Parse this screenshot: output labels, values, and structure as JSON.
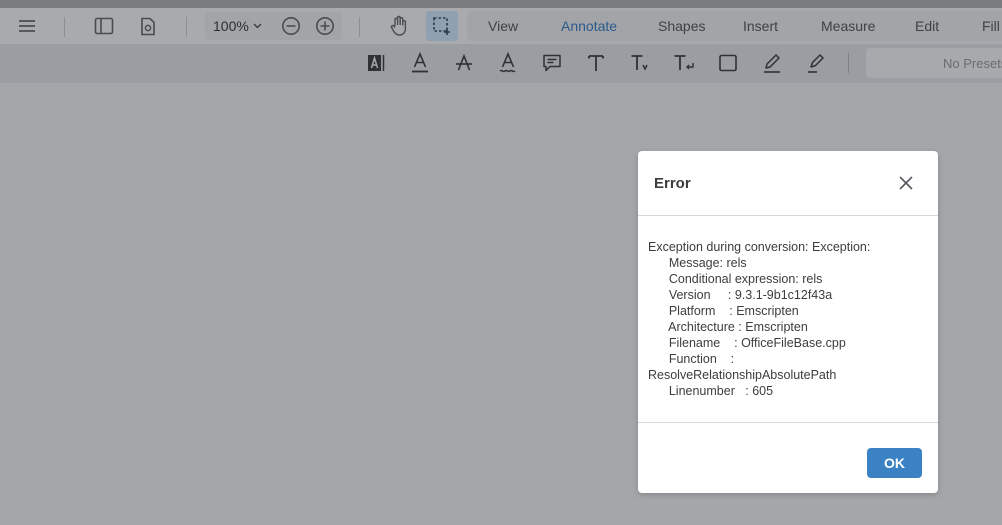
{
  "toolbar": {
    "zoom": "100%",
    "tabs": [
      {
        "label": "View"
      },
      {
        "label": "Annotate",
        "active": true
      },
      {
        "label": "Shapes"
      },
      {
        "label": "Insert"
      },
      {
        "label": "Measure"
      },
      {
        "label": "Edit"
      },
      {
        "label": "Fill"
      }
    ],
    "active_tab_color": "#2c5a8c"
  },
  "subtoolbar": {
    "presets_placeholder": "No Presets"
  },
  "dialog": {
    "title": "Error",
    "lines": [
      "Exception during conversion: Exception:",
      "      Message: rels",
      "      Conditional expression: rels",
      "      Version     : 9.3.1-9b1c12f43a",
      "      Platform    : Emscripten",
      "      Architecture : Emscripten",
      "      Filename    : OfficeFileBase.cpp",
      "      Function    :",
      "ResolveRelationshipAbsolutePath",
      "      Linenumber   : 605"
    ],
    "ok_label": "OK",
    "ok_color": "#3b82c4"
  }
}
